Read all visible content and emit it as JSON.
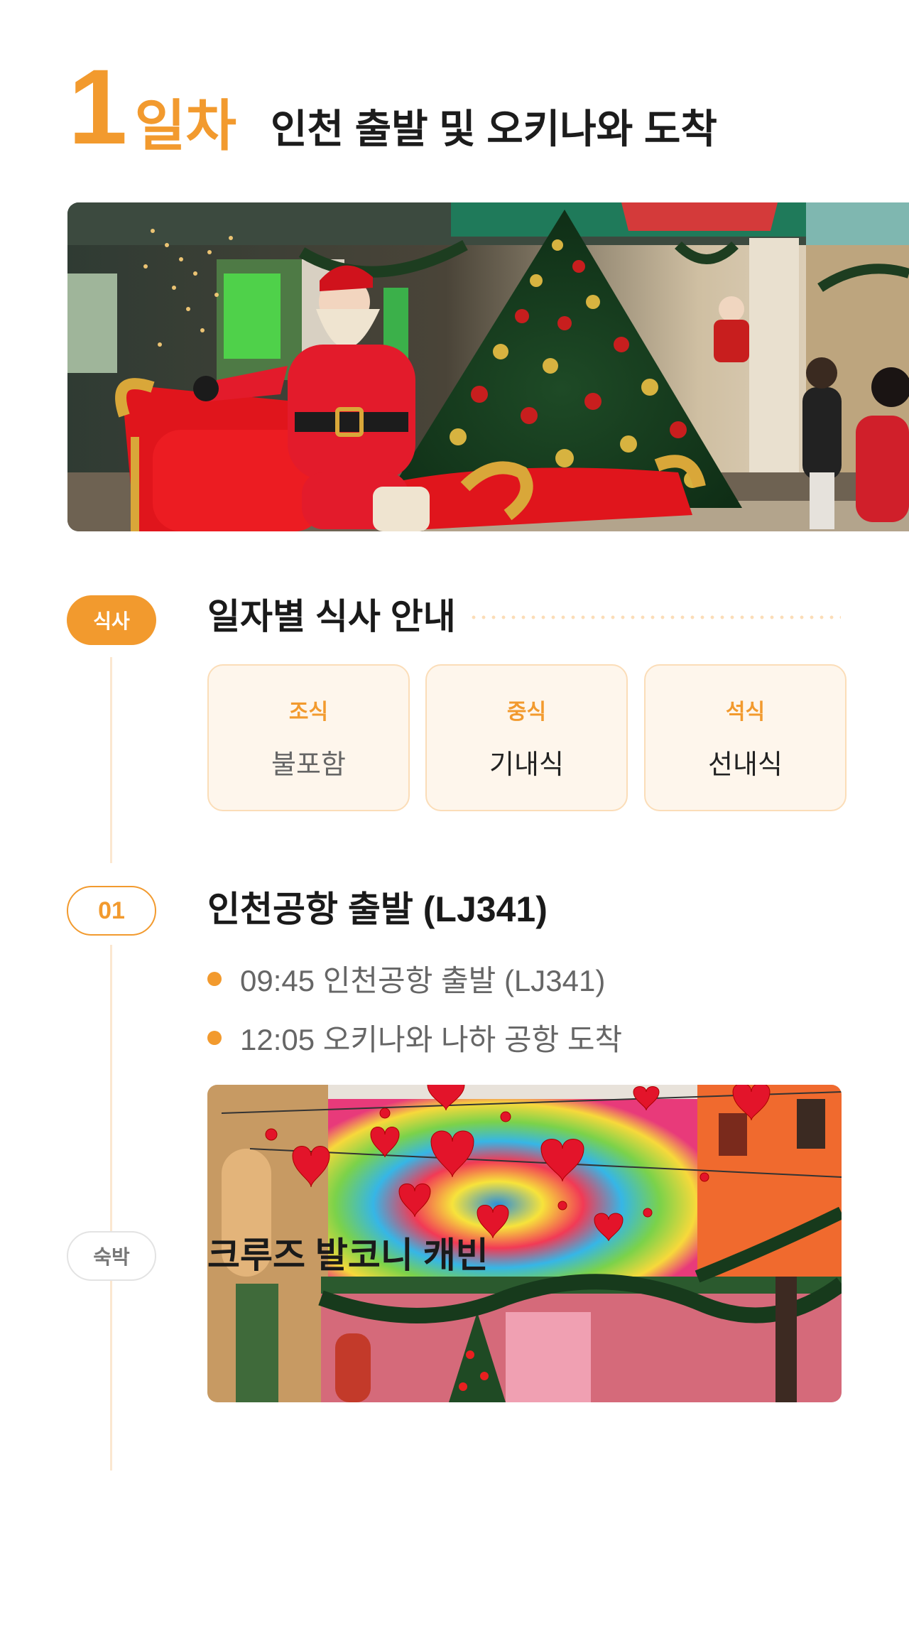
{
  "day": {
    "number": "1",
    "label": "일차",
    "title": "인천 출발 및 오키나와 도착"
  },
  "meals": {
    "badge": "식사",
    "title": "일자별 식사 안내",
    "items": [
      {
        "type": "조식",
        "value": "불포함"
      },
      {
        "type": "중식",
        "value": "기내식"
      },
      {
        "type": "석식",
        "value": "선내식"
      }
    ]
  },
  "step1": {
    "badge": "01",
    "title": "인천공항 출발 (LJ341)",
    "bullets": [
      "09:45 인천공항 출발 (LJ341)",
      "12:05 오키나와 나하 공항 도착"
    ]
  },
  "lodging": {
    "badge": "숙박",
    "title": "크루즈 발코니 캐빈"
  },
  "colors": {
    "accent": "#F29A2E",
    "card_bg": "#FEF6EC",
    "card_border": "#FBDDB8",
    "timeline": "#FBE7D0"
  }
}
